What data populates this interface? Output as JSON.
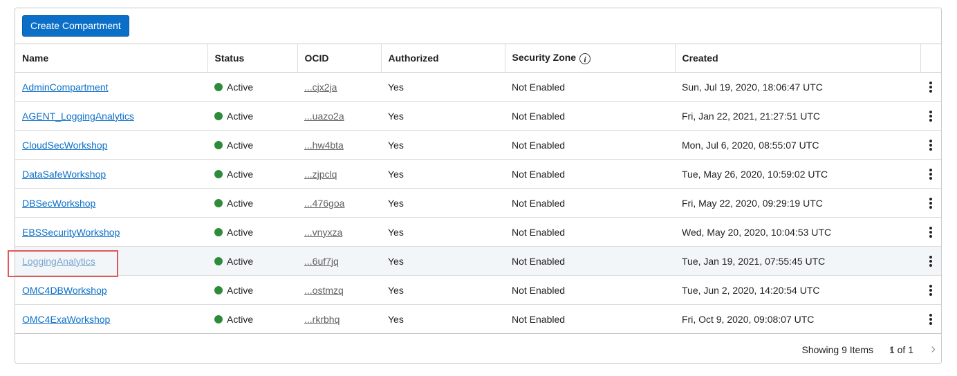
{
  "toolbar": {
    "create_label": "Create Compartment"
  },
  "columns": {
    "name": "Name",
    "status": "Status",
    "ocid": "OCID",
    "authorized": "Authorized",
    "security_zone": "Security Zone",
    "created": "Created"
  },
  "rows": [
    {
      "name": "AdminCompartment",
      "status": "Active",
      "ocid": "...cjx2ja",
      "authorized": "Yes",
      "security_zone": "Not Enabled",
      "created": "Sun, Jul 19, 2020, 18:06:47 UTC"
    },
    {
      "name": "AGENT_LoggingAnalytics",
      "status": "Active",
      "ocid": "...uazo2a",
      "authorized": "Yes",
      "security_zone": "Not Enabled",
      "created": "Fri, Jan 22, 2021, 21:27:51 UTC"
    },
    {
      "name": "CloudSecWorkshop",
      "status": "Active",
      "ocid": "...hw4bta",
      "authorized": "Yes",
      "security_zone": "Not Enabled",
      "created": "Mon, Jul 6, 2020, 08:55:07 UTC"
    },
    {
      "name": "DataSafeWorkshop",
      "status": "Active",
      "ocid": "...zjpclq",
      "authorized": "Yes",
      "security_zone": "Not Enabled",
      "created": "Tue, May 26, 2020, 10:59:02 UTC"
    },
    {
      "name": "DBSecWorkshop",
      "status": "Active",
      "ocid": "...476goa",
      "authorized": "Yes",
      "security_zone": "Not Enabled",
      "created": "Fri, May 22, 2020, 09:29:19 UTC"
    },
    {
      "name": "EBSSecurityWorkshop",
      "status": "Active",
      "ocid": "...vnyxza",
      "authorized": "Yes",
      "security_zone": "Not Enabled",
      "created": "Wed, May 20, 2020, 10:04:53 UTC"
    },
    {
      "name": "LoggingAnalytics",
      "status": "Active",
      "ocid": "...6uf7jq",
      "authorized": "Yes",
      "security_zone": "Not Enabled",
      "created": "Tue, Jan 19, 2021, 07:55:45 UTC",
      "highlighted": true
    },
    {
      "name": "OMC4DBWorkshop",
      "status": "Active",
      "ocid": "...ostmzq",
      "authorized": "Yes",
      "security_zone": "Not Enabled",
      "created": "Tue, Jun 2, 2020, 14:20:54 UTC"
    },
    {
      "name": "OMC4ExaWorkshop",
      "status": "Active",
      "ocid": "...rkrbhq",
      "authorized": "Yes",
      "security_zone": "Not Enabled",
      "created": "Fri, Oct 9, 2020, 09:08:07 UTC"
    }
  ],
  "footer": {
    "showing": "Showing 9 Items",
    "pages": "1 of 1",
    "prev_icon": "chevron-left-icon",
    "next_icon": "chevron-right-icon"
  },
  "colors": {
    "accent": "#0b6fc7",
    "active": "#2e8b3a",
    "highlight_border": "#e0575a"
  },
  "icons": {
    "info": "info-icon",
    "kebab": "kebab-menu-icon",
    "status": "status-dot-icon"
  }
}
